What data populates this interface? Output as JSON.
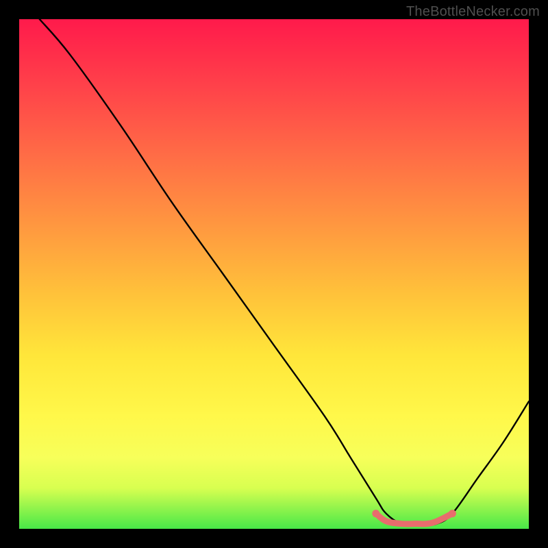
{
  "watermark": "TheBottleNecker.com",
  "chart_data": {
    "type": "line",
    "title": "",
    "xlabel": "",
    "ylabel": "",
    "xlim": [
      0,
      100
    ],
    "ylim": [
      0,
      100
    ],
    "x": [
      4,
      10,
      20,
      30,
      40,
      50,
      60,
      65,
      70,
      72,
      75,
      78,
      80,
      82,
      85,
      90,
      95,
      100
    ],
    "values": [
      100,
      93,
      79,
      64,
      50,
      36,
      22,
      14,
      6,
      3,
      1,
      1,
      1,
      1,
      3,
      10,
      17,
      25
    ],
    "flat_region": {
      "x_start": 70,
      "x_end": 85,
      "y": 1
    },
    "series": [
      {
        "name": "curve",
        "color": "#000000",
        "x": [
          4,
          10,
          20,
          30,
          40,
          50,
          60,
          65,
          70,
          72,
          75,
          78,
          80,
          82,
          85,
          90,
          95,
          100
        ],
        "values": [
          100,
          93,
          79,
          64,
          50,
          36,
          22,
          14,
          6,
          3,
          1,
          1,
          1,
          1,
          3,
          10,
          17,
          25
        ]
      },
      {
        "name": "flat-highlight",
        "color": "#e86d6d",
        "x": [
          70,
          72,
          75,
          78,
          80,
          82,
          85
        ],
        "values": [
          3,
          1.5,
          1,
          1,
          1,
          1.5,
          3
        ]
      }
    ]
  }
}
